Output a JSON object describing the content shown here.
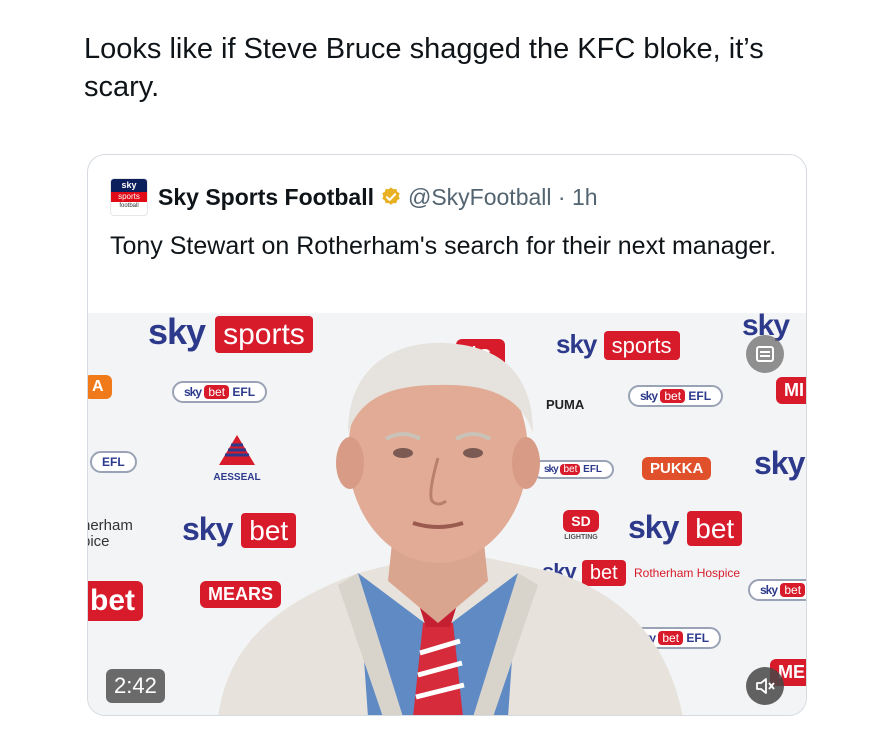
{
  "post": {
    "text": "Looks like if Steve Bruce shagged the KFC bloke, it’s scary."
  },
  "quoted": {
    "avatar": {
      "line1": "sky",
      "line2": "sports",
      "line3": "football"
    },
    "author_name": "Sky Sports Football",
    "handle_time": "@SkyFootball · 1h",
    "text": "Tony Stewart on Rotherham's search for their next manager."
  },
  "media": {
    "duration": "2:42",
    "boards": {
      "sky": "sky",
      "sports": "sports",
      "bet": "bet",
      "efl": "EFL",
      "puma": "PUMA",
      "pukka": "PUKKA",
      "mears": "MEARS",
      "rotherham_hospice": "Rotherham Hospice",
      "aessal": "AESSEAL",
      "lighting": "LIGHTING",
      "partial_hospice_1": "herham",
      "partial_hospice_2": "pice",
      "partial_a": "A",
      "partial_me": "ME",
      "partial_mi": "MI",
      "partial_ts": "ts",
      "partial_et": "et"
    }
  },
  "colors": {
    "text": "#0f1419",
    "muted": "#536471",
    "sky_blue": "#2d3a8c",
    "sky_red": "#d81b2b",
    "verified_gold": "#e8b124"
  },
  "icons": [
    "verified-badge-icon",
    "gif-alt-icon",
    "mute-icon"
  ]
}
